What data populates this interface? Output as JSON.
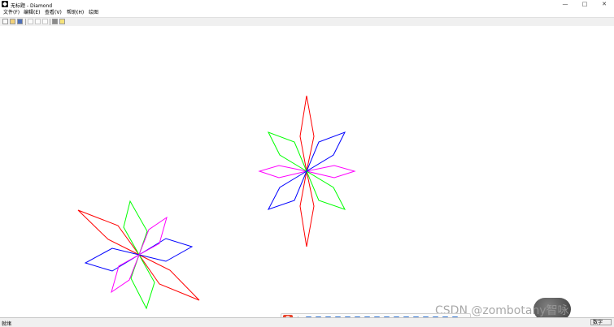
{
  "window": {
    "title": "无标题 - Diamond",
    "controls": {
      "minimize": "—",
      "maximize": "□",
      "close": "✕"
    }
  },
  "menu": {
    "items": [
      "文件(F)",
      "编辑(E)",
      "查看(V)",
      "帮助(H)",
      "绘图"
    ]
  },
  "toolbar": {
    "buttons": [
      "new-icon",
      "open-icon",
      "save-icon",
      "cut-icon",
      "copy-icon",
      "paste-icon",
      "print-icon",
      "help-icon"
    ]
  },
  "statusbar": {
    "left_text": "就绪",
    "right_text": "数字"
  },
  "ime": {
    "logo": "S",
    "label": "中"
  },
  "watermark": "CSDN @zombotany智咏",
  "colors": {
    "red": "#ff0000",
    "green": "#00ff00",
    "blue": "#0000ff",
    "magenta": "#ff00ff"
  }
}
